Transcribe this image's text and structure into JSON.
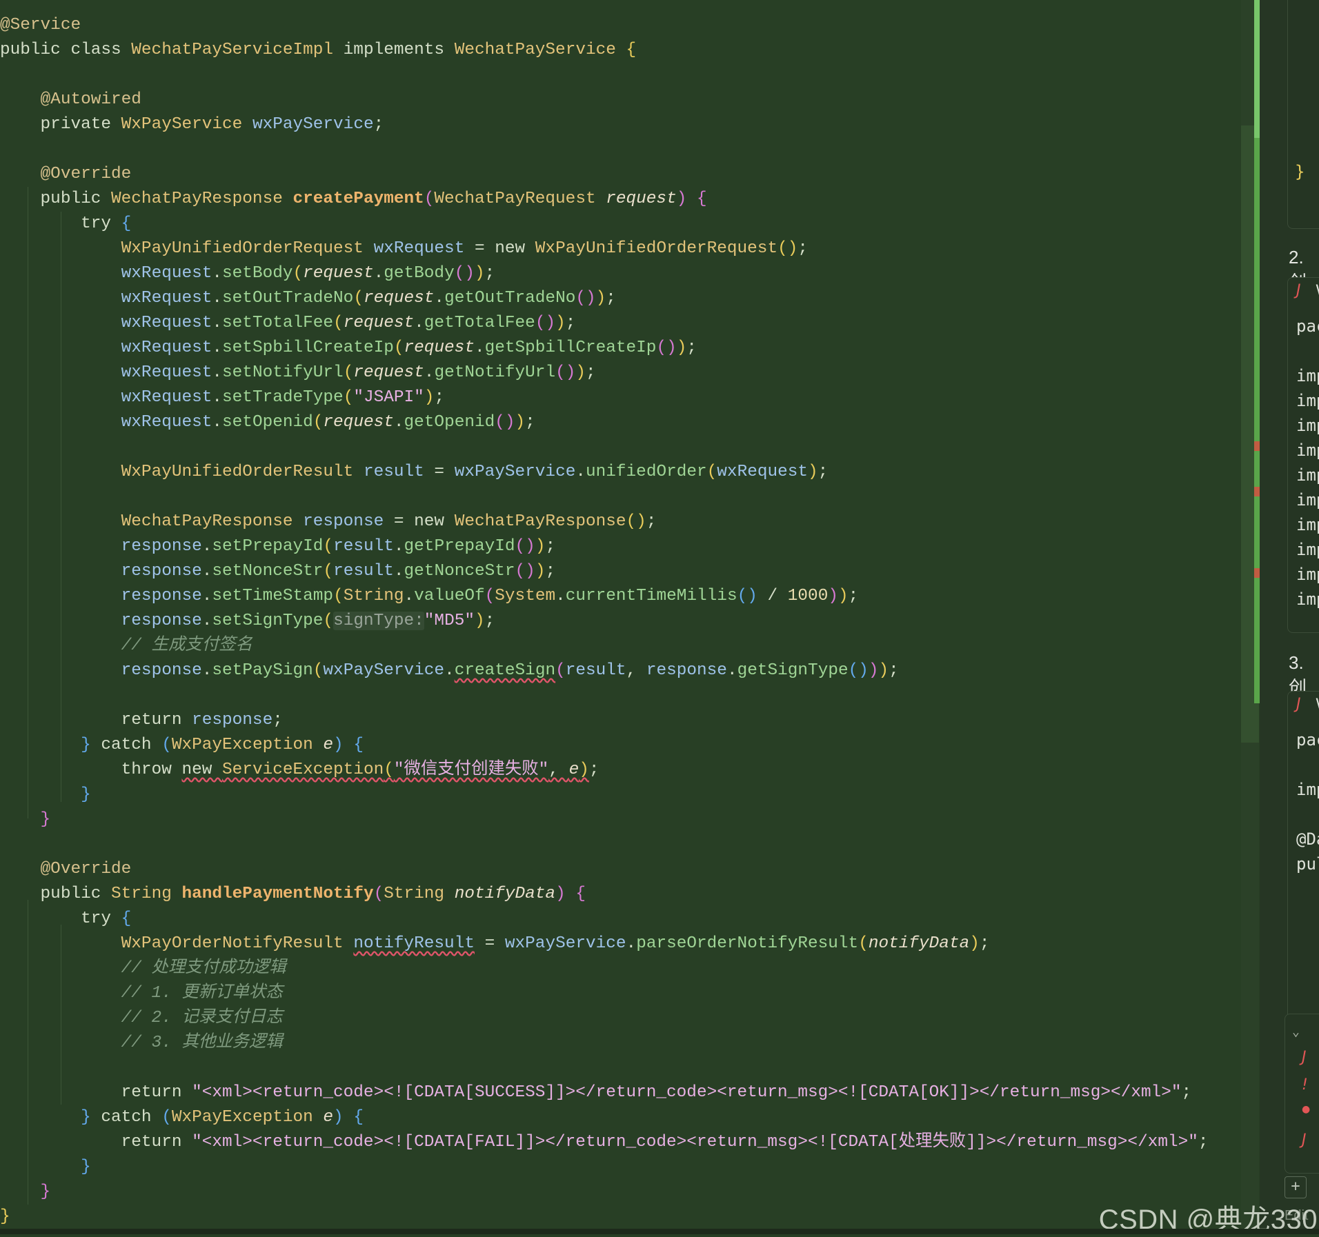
{
  "editor": {
    "lines": [
      [
        {
          "c": "ann",
          "t": "@Service"
        }
      ],
      [
        {
          "c": "kw",
          "t": "public class "
        },
        {
          "c": "ty",
          "t": "WechatPayServiceImpl"
        },
        {
          "c": "kw",
          "t": " implements "
        },
        {
          "c": "ty",
          "t": "WechatPayService"
        },
        {
          "c": "p1",
          "t": " {"
        }
      ],
      [],
      [
        {
          "c": "ann",
          "t": "    @Autowired"
        }
      ],
      [
        {
          "c": "kw",
          "t": "    private "
        },
        {
          "c": "ty",
          "t": "WxPayService"
        },
        {
          "c": "fld",
          "t": " wxPayService"
        },
        {
          "c": "kw",
          "t": ";"
        }
      ],
      [],
      [
        {
          "c": "ann",
          "t": "    @Override"
        }
      ],
      [
        {
          "c": "kw",
          "t": "    public "
        },
        {
          "c": "ty",
          "t": "WechatPayResponse"
        },
        {
          "c": "kw",
          "t": " "
        },
        {
          "c": "dcl",
          "t": "createPayment"
        },
        {
          "c": "p2",
          "t": "("
        },
        {
          "c": "ty",
          "t": "WechatPayRequest"
        },
        {
          "c": "kw",
          "t": " "
        },
        {
          "c": "par",
          "t": "request"
        },
        {
          "c": "p2",
          "t": ")"
        },
        {
          "c": "p2",
          "t": " {"
        }
      ],
      [
        {
          "c": "kw",
          "t": "        try "
        },
        {
          "c": "p3",
          "t": "{"
        }
      ],
      [
        {
          "c": "kw",
          "t": "            "
        },
        {
          "c": "ty",
          "t": "WxPayUnifiedOrderRequest"
        },
        {
          "c": "kw",
          "t": " "
        },
        {
          "c": "fld",
          "t": "wxRequest"
        },
        {
          "c": "kw",
          "t": " = new "
        },
        {
          "c": "ty",
          "t": "WxPayUnifiedOrderRequest"
        },
        {
          "c": "p1",
          "t": "()"
        },
        {
          "c": "kw",
          "t": ";"
        }
      ],
      [
        {
          "c": "kw",
          "t": "            "
        },
        {
          "c": "fld",
          "t": "wxRequest"
        },
        {
          "c": "kw",
          "t": "."
        },
        {
          "c": "mth",
          "t": "setBody"
        },
        {
          "c": "p1",
          "t": "("
        },
        {
          "c": "par",
          "t": "request"
        },
        {
          "c": "kw",
          "t": "."
        },
        {
          "c": "mth",
          "t": "getBody"
        },
        {
          "c": "p2",
          "t": "()"
        },
        {
          "c": "p1",
          "t": ")"
        },
        {
          "c": "kw",
          "t": ";"
        }
      ],
      [
        {
          "c": "kw",
          "t": "            "
        },
        {
          "c": "fld",
          "t": "wxRequest"
        },
        {
          "c": "kw",
          "t": "."
        },
        {
          "c": "mth",
          "t": "setOutTradeNo"
        },
        {
          "c": "p1",
          "t": "("
        },
        {
          "c": "par",
          "t": "request"
        },
        {
          "c": "kw",
          "t": "."
        },
        {
          "c": "mth",
          "t": "getOutTradeNo"
        },
        {
          "c": "p2",
          "t": "()"
        },
        {
          "c": "p1",
          "t": ")"
        },
        {
          "c": "kw",
          "t": ";"
        }
      ],
      [
        {
          "c": "kw",
          "t": "            "
        },
        {
          "c": "fld",
          "t": "wxRequest"
        },
        {
          "c": "kw",
          "t": "."
        },
        {
          "c": "mth",
          "t": "setTotalFee"
        },
        {
          "c": "p1",
          "t": "("
        },
        {
          "c": "par",
          "t": "request"
        },
        {
          "c": "kw",
          "t": "."
        },
        {
          "c": "mth",
          "t": "getTotalFee"
        },
        {
          "c": "p2",
          "t": "()"
        },
        {
          "c": "p1",
          "t": ")"
        },
        {
          "c": "kw",
          "t": ";"
        }
      ],
      [
        {
          "c": "kw",
          "t": "            "
        },
        {
          "c": "fld",
          "t": "wxRequest"
        },
        {
          "c": "kw",
          "t": "."
        },
        {
          "c": "mth",
          "t": "setSpbillCreateIp"
        },
        {
          "c": "p1",
          "t": "("
        },
        {
          "c": "par",
          "t": "request"
        },
        {
          "c": "kw",
          "t": "."
        },
        {
          "c": "mth",
          "t": "getSpbillCreateIp"
        },
        {
          "c": "p2",
          "t": "()"
        },
        {
          "c": "p1",
          "t": ")"
        },
        {
          "c": "kw",
          "t": ";"
        }
      ],
      [
        {
          "c": "kw",
          "t": "            "
        },
        {
          "c": "fld",
          "t": "wxRequest"
        },
        {
          "c": "kw",
          "t": "."
        },
        {
          "c": "mth",
          "t": "setNotifyUrl"
        },
        {
          "c": "p1",
          "t": "("
        },
        {
          "c": "par",
          "t": "request"
        },
        {
          "c": "kw",
          "t": "."
        },
        {
          "c": "mth",
          "t": "getNotifyUrl"
        },
        {
          "c": "p2",
          "t": "()"
        },
        {
          "c": "p1",
          "t": ")"
        },
        {
          "c": "kw",
          "t": ";"
        }
      ],
      [
        {
          "c": "kw",
          "t": "            "
        },
        {
          "c": "fld",
          "t": "wxRequest"
        },
        {
          "c": "kw",
          "t": "."
        },
        {
          "c": "mth",
          "t": "setTradeType"
        },
        {
          "c": "p1",
          "t": "("
        },
        {
          "c": "str",
          "t": "\"JSAPI\""
        },
        {
          "c": "p1",
          "t": ")"
        },
        {
          "c": "kw",
          "t": ";"
        }
      ],
      [
        {
          "c": "kw",
          "t": "            "
        },
        {
          "c": "fld",
          "t": "wxRequest"
        },
        {
          "c": "kw",
          "t": "."
        },
        {
          "c": "mth",
          "t": "setOpenid"
        },
        {
          "c": "p1",
          "t": "("
        },
        {
          "c": "par",
          "t": "request"
        },
        {
          "c": "kw",
          "t": "."
        },
        {
          "c": "mth",
          "t": "getOpenid"
        },
        {
          "c": "p2",
          "t": "()"
        },
        {
          "c": "p1",
          "t": ")"
        },
        {
          "c": "kw",
          "t": ";"
        }
      ],
      [],
      [
        {
          "c": "kw",
          "t": "            "
        },
        {
          "c": "ty",
          "t": "WxPayUnifiedOrderResult"
        },
        {
          "c": "kw",
          "t": " "
        },
        {
          "c": "fld",
          "t": "result"
        },
        {
          "c": "kw",
          "t": " = "
        },
        {
          "c": "fld",
          "t": "wxPayService"
        },
        {
          "c": "kw",
          "t": "."
        },
        {
          "c": "mth",
          "t": "unifiedOrder"
        },
        {
          "c": "p1",
          "t": "("
        },
        {
          "c": "fld",
          "t": "wxRequest"
        },
        {
          "c": "p1",
          "t": ")"
        },
        {
          "c": "kw",
          "t": ";"
        }
      ],
      [],
      [
        {
          "c": "kw",
          "t": "            "
        },
        {
          "c": "ty",
          "t": "WechatPayResponse"
        },
        {
          "c": "kw",
          "t": " "
        },
        {
          "c": "fld",
          "t": "response"
        },
        {
          "c": "kw",
          "t": " = new "
        },
        {
          "c": "ty",
          "t": "WechatPayResponse"
        },
        {
          "c": "p1",
          "t": "()"
        },
        {
          "c": "kw",
          "t": ";"
        }
      ],
      [
        {
          "c": "kw",
          "t": "            "
        },
        {
          "c": "fld",
          "t": "response"
        },
        {
          "c": "kw",
          "t": "."
        },
        {
          "c": "mth",
          "t": "setPrepayId"
        },
        {
          "c": "p1",
          "t": "("
        },
        {
          "c": "fld",
          "t": "result"
        },
        {
          "c": "kw",
          "t": "."
        },
        {
          "c": "mth",
          "t": "getPrepayId"
        },
        {
          "c": "p2",
          "t": "()"
        },
        {
          "c": "p1",
          "t": ")"
        },
        {
          "c": "kw",
          "t": ";"
        }
      ],
      [
        {
          "c": "kw",
          "t": "            "
        },
        {
          "c": "fld",
          "t": "response"
        },
        {
          "c": "kw",
          "t": "."
        },
        {
          "c": "mth",
          "t": "setNonceStr"
        },
        {
          "c": "p1",
          "t": "("
        },
        {
          "c": "fld",
          "t": "result"
        },
        {
          "c": "kw",
          "t": "."
        },
        {
          "c": "mth",
          "t": "getNonceStr"
        },
        {
          "c": "p2",
          "t": "()"
        },
        {
          "c": "p1",
          "t": ")"
        },
        {
          "c": "kw",
          "t": ";"
        }
      ],
      [
        {
          "c": "kw",
          "t": "            "
        },
        {
          "c": "fld",
          "t": "response"
        },
        {
          "c": "kw",
          "t": "."
        },
        {
          "c": "mth",
          "t": "setTimeStamp"
        },
        {
          "c": "p1",
          "t": "("
        },
        {
          "c": "ty",
          "t": "String"
        },
        {
          "c": "kw",
          "t": "."
        },
        {
          "c": "mth",
          "t": "valueOf"
        },
        {
          "c": "p2",
          "t": "("
        },
        {
          "c": "ty",
          "t": "System"
        },
        {
          "c": "kw",
          "t": "."
        },
        {
          "c": "mth",
          "t": "currentTimeMillis"
        },
        {
          "c": "p3",
          "t": "()"
        },
        {
          "c": "kw",
          "t": " / "
        },
        {
          "c": "num",
          "t": "1000"
        },
        {
          "c": "p2",
          "t": ")"
        },
        {
          "c": "p1",
          "t": ")"
        },
        {
          "c": "kw",
          "t": ";"
        }
      ],
      [
        {
          "c": "kw",
          "t": "            "
        },
        {
          "c": "fld",
          "t": "response"
        },
        {
          "c": "kw",
          "t": "."
        },
        {
          "c": "mth",
          "t": "setSignType"
        },
        {
          "c": "p1",
          "t": "("
        },
        {
          "c": "hint",
          "t": "signType:"
        },
        {
          "c": "str",
          "t": "\"MD5\""
        },
        {
          "c": "p1",
          "t": ")"
        },
        {
          "c": "kw",
          "t": ";"
        }
      ],
      [
        {
          "c": "cmt",
          "t": "            // 生成支付签名"
        }
      ],
      [
        {
          "c": "kw",
          "t": "            "
        },
        {
          "c": "fld",
          "t": "response"
        },
        {
          "c": "kw",
          "t": "."
        },
        {
          "c": "mth",
          "t": "setPaySign"
        },
        {
          "c": "p1",
          "t": "("
        },
        {
          "c": "fld",
          "t": "wxPayService"
        },
        {
          "c": "kw",
          "t": "."
        },
        {
          "c": "mth squig",
          "t": "createSign"
        },
        {
          "c": "p2",
          "t": "("
        },
        {
          "c": "fld",
          "t": "result"
        },
        {
          "c": "kw",
          "t": ", "
        },
        {
          "c": "fld",
          "t": "response"
        },
        {
          "c": "kw",
          "t": "."
        },
        {
          "c": "mth",
          "t": "getSignType"
        },
        {
          "c": "p3",
          "t": "()"
        },
        {
          "c": "p2",
          "t": ")"
        },
        {
          "c": "p1",
          "t": ")"
        },
        {
          "c": "kw",
          "t": ";"
        }
      ],
      [],
      [
        {
          "c": "kw",
          "t": "            return "
        },
        {
          "c": "fld",
          "t": "response"
        },
        {
          "c": "kw",
          "t": ";"
        }
      ],
      [
        {
          "c": "p3",
          "t": "        }"
        },
        {
          "c": "kw",
          "t": " catch "
        },
        {
          "c": "p3",
          "t": "("
        },
        {
          "c": "ty",
          "t": "WxPayException"
        },
        {
          "c": "kw",
          "t": " "
        },
        {
          "c": "par",
          "t": "e"
        },
        {
          "c": "p3",
          "t": ")"
        },
        {
          "c": "p3",
          "t": " {"
        }
      ],
      [
        {
          "c": "kw",
          "t": "            throw "
        },
        {
          "c": "kw squig",
          "t": "new "
        },
        {
          "c": "ty squig",
          "t": "ServiceException"
        },
        {
          "c": "p1 squig",
          "t": "("
        },
        {
          "c": "str squig",
          "t": "\"微信支付创建失败\""
        },
        {
          "c": "kw squig",
          "t": ", "
        },
        {
          "c": "par squig",
          "t": "e"
        },
        {
          "c": "p1 squig",
          "t": ")"
        },
        {
          "c": "kw",
          "t": ";"
        }
      ],
      [
        {
          "c": "p3",
          "t": "        }"
        }
      ],
      [
        {
          "c": "p2",
          "t": "    }"
        }
      ],
      [],
      [
        {
          "c": "ann",
          "t": "    @Override"
        }
      ],
      [
        {
          "c": "kw",
          "t": "    public "
        },
        {
          "c": "ty",
          "t": "String"
        },
        {
          "c": "kw",
          "t": " "
        },
        {
          "c": "dcl",
          "t": "handlePaymentNotify"
        },
        {
          "c": "p2",
          "t": "("
        },
        {
          "c": "ty",
          "t": "String"
        },
        {
          "c": "kw",
          "t": " "
        },
        {
          "c": "par",
          "t": "notifyData"
        },
        {
          "c": "p2",
          "t": ")"
        },
        {
          "c": "p2",
          "t": " {"
        }
      ],
      [
        {
          "c": "kw",
          "t": "        try "
        },
        {
          "c": "p3",
          "t": "{"
        }
      ],
      [
        {
          "c": "kw",
          "t": "            "
        },
        {
          "c": "ty",
          "t": "WxPayOrderNotifyResult"
        },
        {
          "c": "kw",
          "t": " "
        },
        {
          "c": "fld squig",
          "t": "notifyResult"
        },
        {
          "c": "kw",
          "t": " = "
        },
        {
          "c": "fld",
          "t": "wxPayService"
        },
        {
          "c": "kw",
          "t": "."
        },
        {
          "c": "mth",
          "t": "parseOrderNotifyResult"
        },
        {
          "c": "p1",
          "t": "("
        },
        {
          "c": "par",
          "t": "notifyData"
        },
        {
          "c": "p1",
          "t": ")"
        },
        {
          "c": "kw",
          "t": ";"
        }
      ],
      [
        {
          "c": "cmt",
          "t": "            // 处理支付成功逻辑"
        }
      ],
      [
        {
          "c": "cmt",
          "t": "            // 1. 更新订单状态"
        }
      ],
      [
        {
          "c": "cmt",
          "t": "            // 2. 记录支付日志"
        }
      ],
      [
        {
          "c": "cmt",
          "t": "            // 3. 其他业务逻辑"
        }
      ],
      [],
      [
        {
          "c": "kw",
          "t": "            return "
        },
        {
          "c": "str",
          "t": "\"<xml><return_code><![CDATA[SUCCESS]]></return_code><return_msg><![CDATA[OK]]></return_msg></xml>\""
        },
        {
          "c": "kw",
          "t": ";"
        }
      ],
      [
        {
          "c": "p3",
          "t": "        }"
        },
        {
          "c": "kw",
          "t": " catch "
        },
        {
          "c": "p3",
          "t": "("
        },
        {
          "c": "ty",
          "t": "WxPayException"
        },
        {
          "c": "kw",
          "t": " "
        },
        {
          "c": "par",
          "t": "e"
        },
        {
          "c": "p3",
          "t": ")"
        },
        {
          "c": "p3",
          "t": " {"
        }
      ],
      [
        {
          "c": "kw",
          "t": "            return "
        },
        {
          "c": "str",
          "t": "\"<xml><return_code><![CDATA[FAIL]]></return_code><return_msg><![CDATA[处理失败]]></return_msg></xml>\""
        },
        {
          "c": "kw",
          "t": ";"
        }
      ],
      [
        {
          "c": "p3",
          "t": "        }"
        }
      ],
      [
        {
          "c": "p2",
          "t": "    }"
        }
      ],
      [
        {
          "c": "p1",
          "t": "}"
        }
      ]
    ]
  },
  "side_panel": {
    "top_brace": "}",
    "steps": [
      {
        "label": "2. 创"
      },
      {
        "label": "3. 创"
      }
    ],
    "card1_lines": [
      "pac",
      "",
      "imp",
      "imp",
      "imp",
      "imp",
      "imp",
      "imp",
      "imp",
      "imp",
      "imp",
      "imp"
    ],
    "card2_lines": [
      "pac",
      "",
      "imp",
      "",
      "@Da",
      "pul"
    ],
    "file_icon": "J",
    "file_name_fragment": "V",
    "bottom_icons": [
      "J",
      "!",
      "●",
      "J"
    ],
    "bottom_label": "Edit",
    "add_button": "+"
  },
  "watermark": "CSDN @典龙330"
}
